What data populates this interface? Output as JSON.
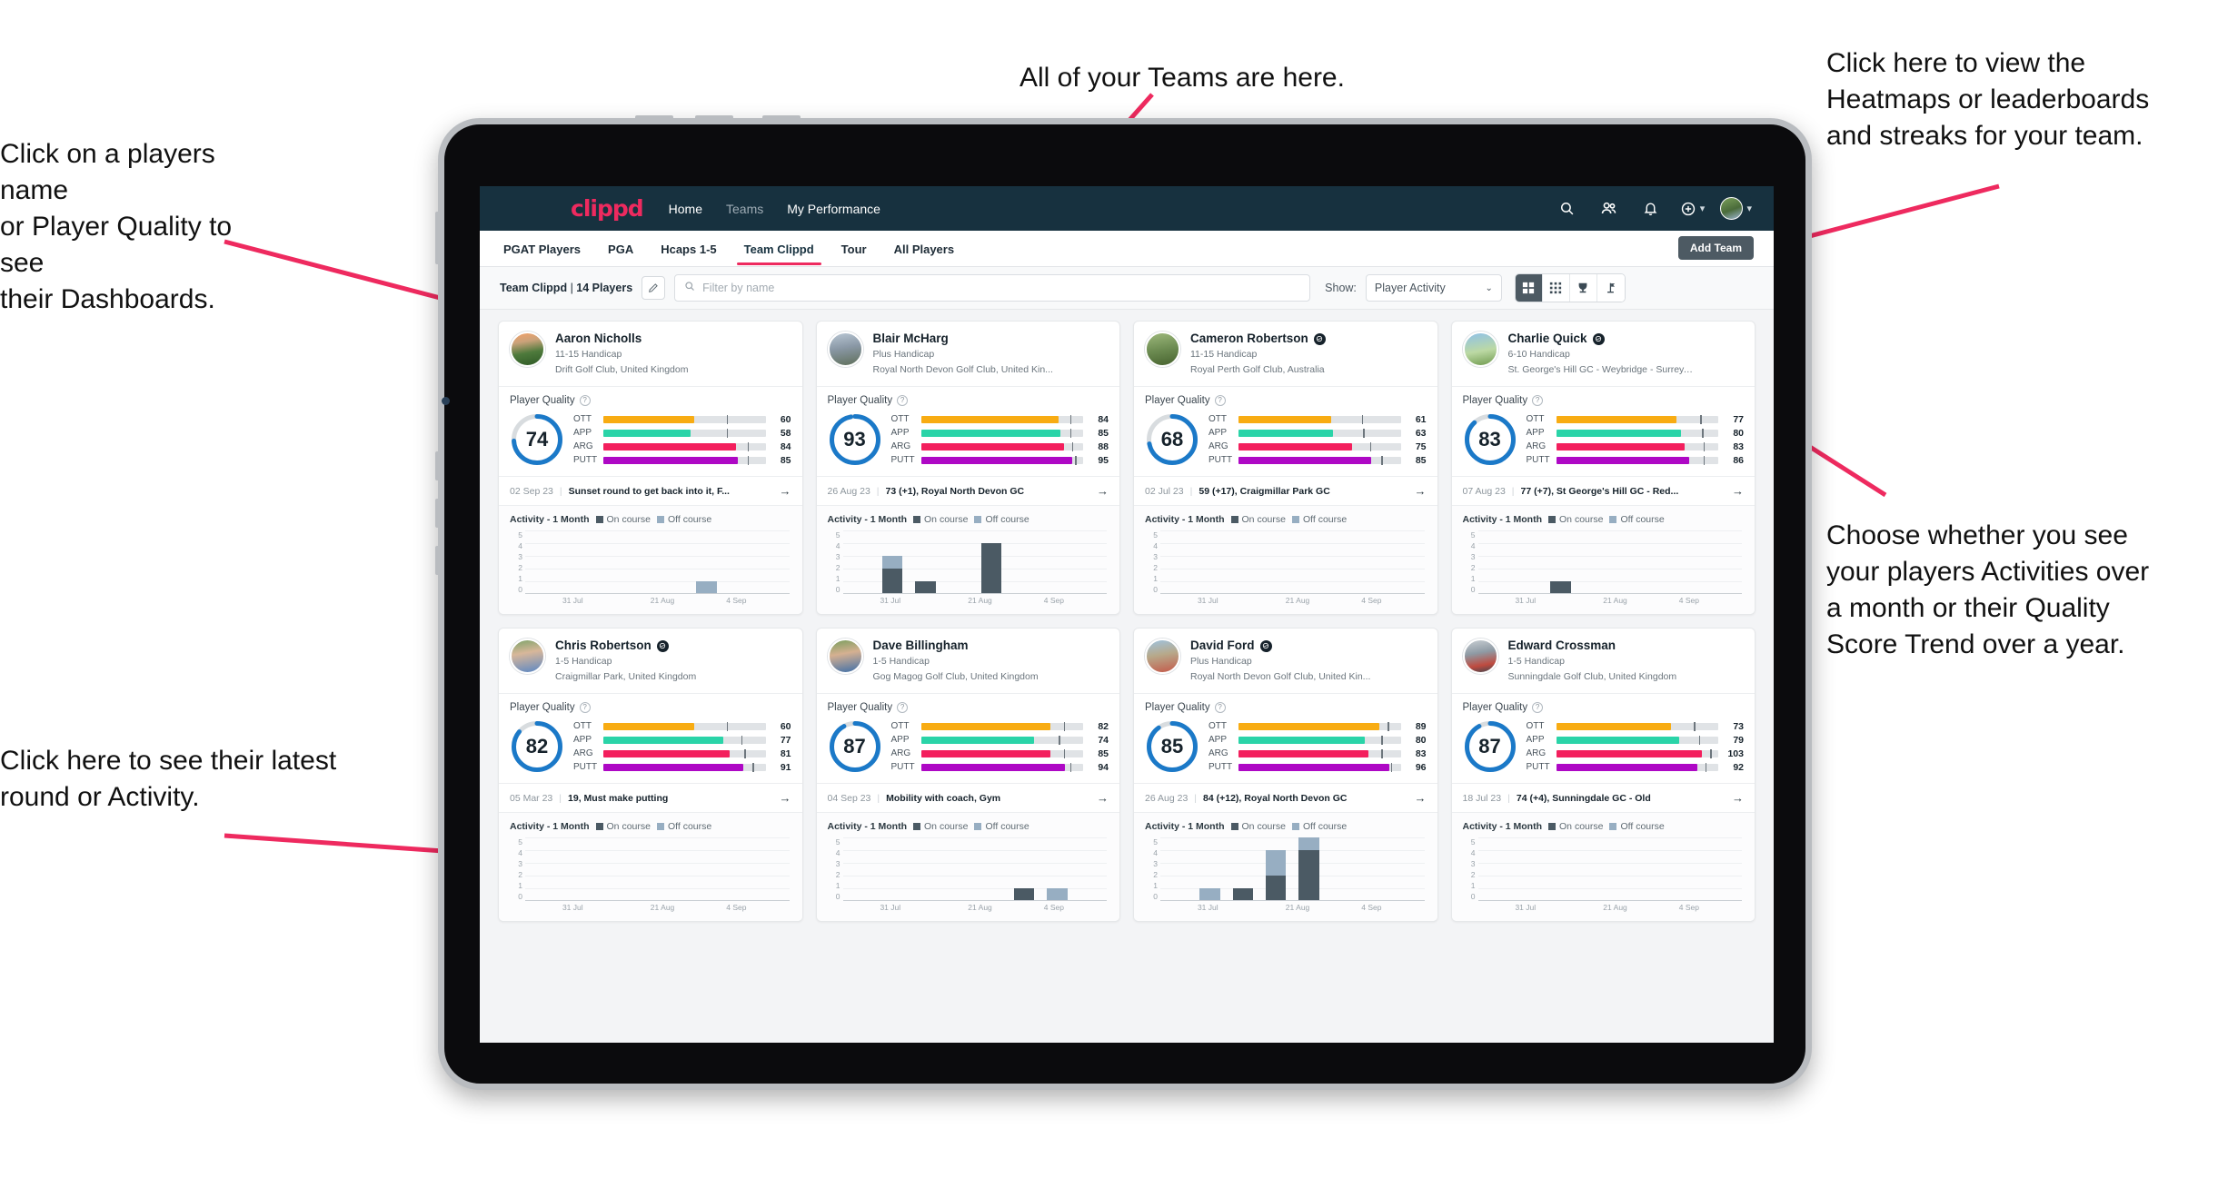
{
  "annotations": [
    {
      "id": "a-players",
      "text": "Click on a players name\nor Player Quality to see\ntheir Dashboards."
    },
    {
      "id": "a-teams",
      "text": "All of your Teams are here."
    },
    {
      "id": "a-heatmaps",
      "text": "Click here to view the\nHeatmaps or leaderboards\nand streaks for your team."
    },
    {
      "id": "a-show",
      "text": "Choose whether you see\nyour players Activities over\na month or their Quality\nScore Trend over a year."
    },
    {
      "id": "a-round",
      "text": "Click here to see their latest\nround or Activity."
    }
  ],
  "app": {
    "brand": "clippd",
    "nav": [
      {
        "label": "Home",
        "active": true
      },
      {
        "label": "Teams",
        "active": false
      },
      {
        "label": "My Performance",
        "active": true
      }
    ],
    "icons": [
      "search-icon",
      "people-icon",
      "bell-icon",
      "plus-circle-icon",
      "avatar"
    ],
    "tabs": [
      {
        "label": "PGAT Players",
        "active": false
      },
      {
        "label": "PGA",
        "active": false
      },
      {
        "label": "Hcaps 1-5",
        "active": false
      },
      {
        "label": "Team Clippd",
        "active": true
      },
      {
        "label": "Tour",
        "active": false
      },
      {
        "label": "All Players",
        "active": false
      }
    ],
    "add_team_label": "Add Team",
    "toolbar": {
      "team_name": "Team Clippd",
      "team_count": "14 Players",
      "edit_icon": "pencil-icon",
      "search_placeholder": "Filter by name",
      "search_value": "",
      "show_label": "Show:",
      "show_value": "Player Activity",
      "views": [
        {
          "icon": "grid-large-icon",
          "selected": true
        },
        {
          "icon": "grid-small-icon",
          "selected": false
        },
        {
          "icon": "trophy-icon",
          "selected": false
        },
        {
          "icon": "flag-icon",
          "selected": false
        }
      ]
    },
    "card_labels": {
      "player_quality": "Player Quality",
      "activity": "Activity - 1 Month",
      "legend_on": "On course",
      "legend_off": "Off course"
    },
    "metric_colors": {
      "OTT": "#f8ac13",
      "APP": "#2ad4a8",
      "ARG": "#f31f5d",
      "PUTT": "#ae08c5",
      "track": "#e0e3e6",
      "ring": "#1b79c8",
      "ring_track": "#d8dcdf"
    }
  },
  "chart_data": {
    "type": "bar",
    "title": "Activity - 1 Month",
    "ylabel": "",
    "ylim": [
      0,
      5
    ],
    "yticks": [
      5,
      4,
      3,
      2,
      1,
      0
    ],
    "xticks": [
      "31 Jul",
      "21 Aug",
      "4 Sep"
    ],
    "stacked": true,
    "series_names": [
      "On course",
      "Off course"
    ],
    "per_player": [
      {
        "player": "Aaron Nicholls",
        "bars": [
          {
            "i": 5,
            "on": 0,
            "off": 1
          }
        ]
      },
      {
        "player": "Blair McHarg",
        "bars": [
          {
            "i": 1,
            "on": 2,
            "off": 1
          },
          {
            "i": 2,
            "on": 1,
            "off": 0
          },
          {
            "i": 4,
            "on": 4,
            "off": 0
          }
        ]
      },
      {
        "player": "Cameron Robertson",
        "bars": []
      },
      {
        "player": "Charlie Quick",
        "bars": [
          {
            "i": 2,
            "on": 1,
            "off": 0
          }
        ]
      },
      {
        "player": "Chris Robertson",
        "bars": []
      },
      {
        "player": "Dave Billingham",
        "bars": [
          {
            "i": 5,
            "on": 1,
            "off": 0
          },
          {
            "i": 6,
            "on": 0,
            "off": 1
          }
        ]
      },
      {
        "player": "David Ford",
        "bars": [
          {
            "i": 1,
            "on": 0,
            "off": 1
          },
          {
            "i": 2,
            "on": 1,
            "off": 0
          },
          {
            "i": 3,
            "on": 2,
            "off": 2
          },
          {
            "i": 4,
            "on": 4,
            "off": 1
          }
        ]
      },
      {
        "player": "Edward Crossman",
        "bars": []
      }
    ]
  },
  "players": [
    {
      "name": "Aaron Nicholls",
      "verified": false,
      "avatar": "av0",
      "handicap": "11-15 Handicap",
      "club": "Drift Golf Club, United Kingdom",
      "quality": 74,
      "ring_pct": 74,
      "metrics": [
        {
          "label": "OTT",
          "value": 60,
          "fill": 56,
          "tick": 76
        },
        {
          "label": "APP",
          "value": 58,
          "fill": 54,
          "tick": 76
        },
        {
          "label": "ARG",
          "value": 84,
          "fill": 82,
          "tick": 89
        },
        {
          "label": "PUTT",
          "value": 85,
          "fill": 83,
          "tick": 89
        }
      ],
      "round_date": "02 Sep 23",
      "round_title": "Sunset round to get back into it, F..."
    },
    {
      "name": "Blair McHarg",
      "verified": false,
      "avatar": "av1",
      "handicap": "Plus Handicap",
      "club": "Royal North Devon Golf Club, United Kin...",
      "quality": 93,
      "ring_pct": 97,
      "metrics": [
        {
          "label": "OTT",
          "value": 84,
          "fill": 85,
          "tick": 92
        },
        {
          "label": "APP",
          "value": 85,
          "fill": 86,
          "tick": 92
        },
        {
          "label": "ARG",
          "value": 88,
          "fill": 88,
          "tick": 93
        },
        {
          "label": "PUTT",
          "value": 95,
          "fill": 93,
          "tick": 95
        }
      ],
      "round_date": "26 Aug 23",
      "round_title": "73 (+1), Royal North Devon GC"
    },
    {
      "name": "Cameron Robertson",
      "verified": true,
      "avatar": "av2",
      "handicap": "11-15 Handicap",
      "club": "Royal Perth Golf Club, Australia",
      "quality": 68,
      "ring_pct": 72,
      "metrics": [
        {
          "label": "OTT",
          "value": 61,
          "fill": 57,
          "tick": 76
        },
        {
          "label": "APP",
          "value": 63,
          "fill": 58,
          "tick": 77
        },
        {
          "label": "ARG",
          "value": 75,
          "fill": 70,
          "tick": 81
        },
        {
          "label": "PUTT",
          "value": 85,
          "fill": 82,
          "tick": 88
        }
      ],
      "round_date": "02 Jul 23",
      "round_title": "59 (+17), Craigmillar Park GC"
    },
    {
      "name": "Charlie Quick",
      "verified": true,
      "avatar": "av3",
      "handicap": "6-10 Handicap",
      "club": "St. George's Hill GC - Weybridge - Surrey, ...",
      "quality": 83,
      "ring_pct": 88,
      "metrics": [
        {
          "label": "OTT",
          "value": 77,
          "fill": 74,
          "tick": 89
        },
        {
          "label": "APP",
          "value": 80,
          "fill": 77,
          "tick": 90
        },
        {
          "label": "ARG",
          "value": 83,
          "fill": 79,
          "tick": 91
        },
        {
          "label": "PUTT",
          "value": 86,
          "fill": 82,
          "tick": 91
        }
      ],
      "round_date": "07 Aug 23",
      "round_title": "77 (+7), St George's Hill GC - Red..."
    },
    {
      "name": "Chris Robertson",
      "verified": true,
      "avatar": "av4",
      "handicap": "1-5 Handicap",
      "club": "Craigmillar Park, United Kingdom",
      "quality": 82,
      "ring_pct": 86,
      "metrics": [
        {
          "label": "OTT",
          "value": 60,
          "fill": 56,
          "tick": 76
        },
        {
          "label": "APP",
          "value": 77,
          "fill": 74,
          "tick": 85
        },
        {
          "label": "ARG",
          "value": 81,
          "fill": 78,
          "tick": 87
        },
        {
          "label": "PUTT",
          "value": 91,
          "fill": 86,
          "tick": 92
        }
      ],
      "round_date": "05 Mar 23",
      "round_title": "19, Must make putting"
    },
    {
      "name": "Dave Billingham",
      "verified": false,
      "avatar": "av5",
      "handicap": "1-5 Handicap",
      "club": "Gog Magog Golf Club, United Kingdom",
      "quality": 87,
      "ring_pct": 92,
      "metrics": [
        {
          "label": "OTT",
          "value": 82,
          "fill": 80,
          "tick": 88
        },
        {
          "label": "APP",
          "value": 74,
          "fill": 70,
          "tick": 85
        },
        {
          "label": "ARG",
          "value": 85,
          "fill": 80,
          "tick": 88
        },
        {
          "label": "PUTT",
          "value": 94,
          "fill": 89,
          "tick": 92
        }
      ],
      "round_date": "04 Sep 23",
      "round_title": "Mobility with coach, Gym"
    },
    {
      "name": "David Ford",
      "verified": true,
      "avatar": "av6",
      "handicap": "Plus Handicap",
      "club": "Royal North Devon Golf Club, United Kin...",
      "quality": 85,
      "ring_pct": 90,
      "metrics": [
        {
          "label": "OTT",
          "value": 89,
          "fill": 87,
          "tick": 92
        },
        {
          "label": "APP",
          "value": 80,
          "fill": 78,
          "tick": 88
        },
        {
          "label": "ARG",
          "value": 83,
          "fill": 80,
          "tick": 88
        },
        {
          "label": "PUTT",
          "value": 96,
          "fill": 93,
          "tick": 94
        }
      ],
      "round_date": "26 Aug 23",
      "round_title": "84 (+12), Royal North Devon GC"
    },
    {
      "name": "Edward Crossman",
      "verified": false,
      "avatar": "av7",
      "handicap": "1-5 Handicap",
      "club": "Sunningdale Golf Club, United Kingdom",
      "quality": 87,
      "ring_pct": 92,
      "metrics": [
        {
          "label": "OTT",
          "value": 73,
          "fill": 71,
          "tick": 85
        },
        {
          "label": "APP",
          "value": 79,
          "fill": 76,
          "tick": 88
        },
        {
          "label": "ARG",
          "value": 103,
          "fill": 90,
          "tick": 95
        },
        {
          "label": "PUTT",
          "value": 92,
          "fill": 87,
          "tick": 92
        }
      ],
      "round_date": "18 Jul 23",
      "round_title": "74 (+4), Sunningdale GC - Old"
    }
  ]
}
